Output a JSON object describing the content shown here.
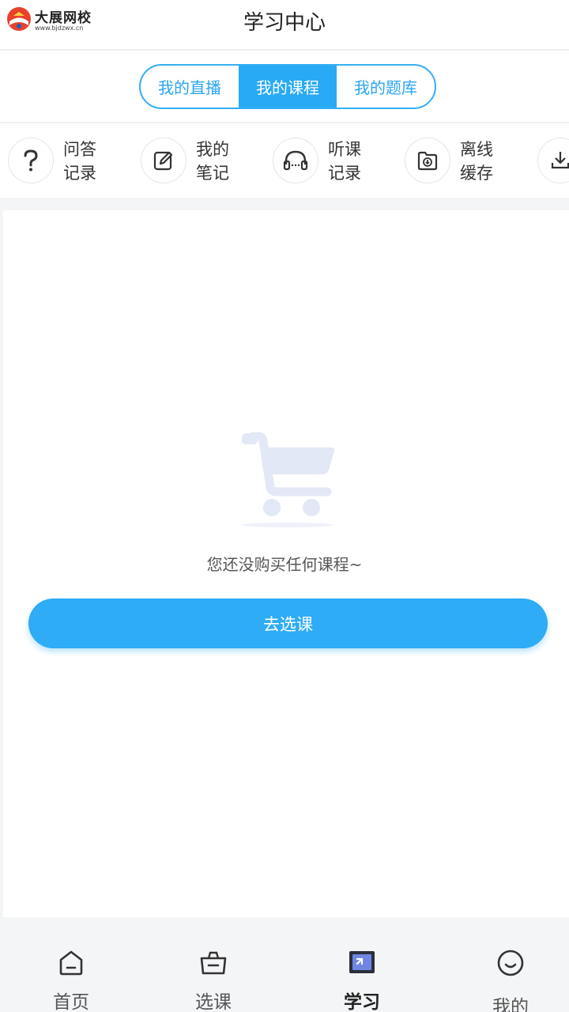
{
  "header": {
    "logo_name": "大展网校",
    "logo_url": "www.bjdzwx.cn",
    "title": "学习中心"
  },
  "tabs": [
    {
      "label": "我的直播",
      "active": false
    },
    {
      "label": "我的课程",
      "active": true
    },
    {
      "label": "我的题库",
      "active": false
    }
  ],
  "quick_links": [
    {
      "line1": "问答",
      "line2": "记录",
      "icon": "question-icon"
    },
    {
      "line1": "我的",
      "line2": "笔记",
      "icon": "edit-note-icon"
    },
    {
      "line1": "听课",
      "line2": "记录",
      "icon": "headphones-icon"
    },
    {
      "line1": "离线",
      "line2": "缓存",
      "icon": "folder-download-icon"
    },
    {
      "line1": "",
      "line2": "",
      "icon": "download-icon"
    }
  ],
  "empty_state": {
    "icon": "cart-icon",
    "message": "您还没购买任何课程~",
    "button_label": "去选课"
  },
  "bottom_nav": [
    {
      "label": "首页",
      "icon": "home-icon",
      "active": false
    },
    {
      "label": "选课",
      "icon": "basket-icon",
      "active": false
    },
    {
      "label": "学习",
      "icon": "study-icon",
      "active": true
    },
    {
      "label": "我的",
      "icon": "smile-icon",
      "active": false
    }
  ],
  "colors": {
    "accent": "#29aaf4",
    "cart": "#e3e8f6",
    "background": "#f4f5f7"
  }
}
